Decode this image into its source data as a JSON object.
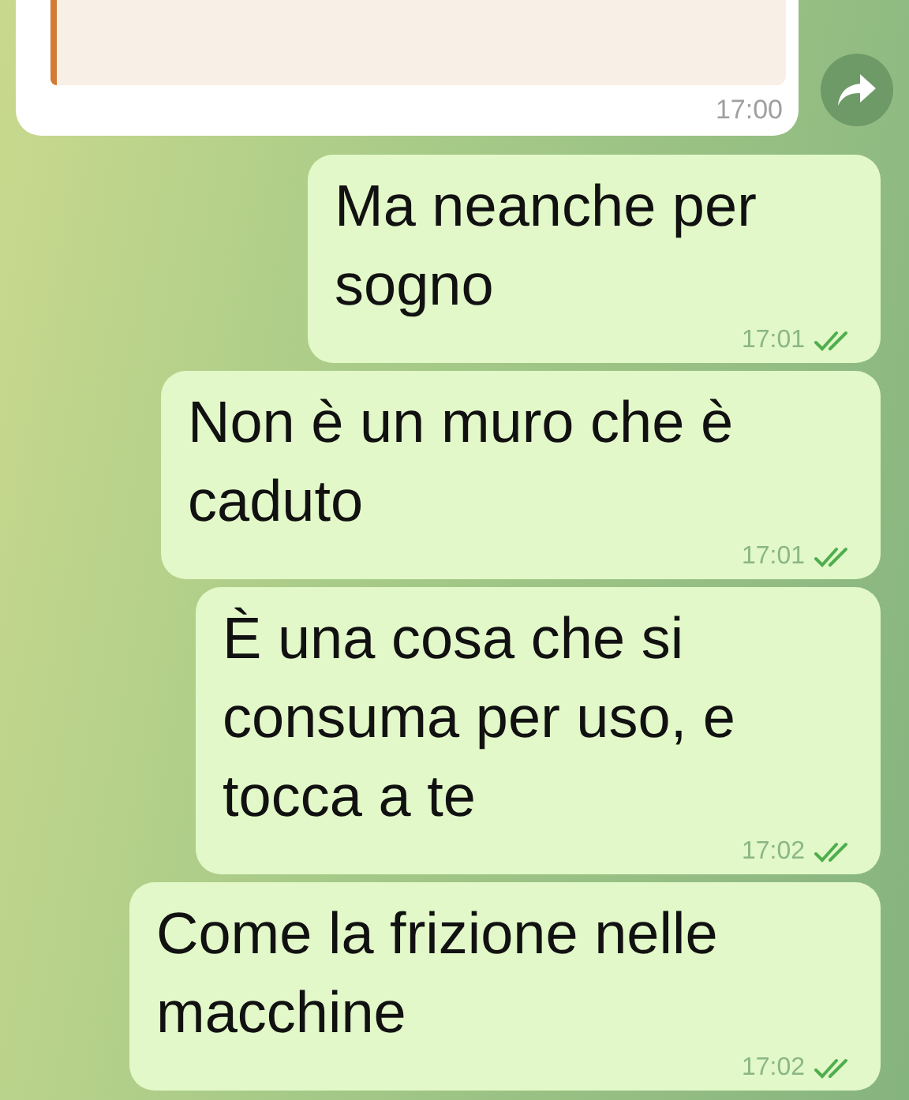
{
  "incoming": {
    "time": "17:00"
  },
  "messages": [
    {
      "text": "Ma neanche per sogno",
      "time": "17:01",
      "read": true
    },
    {
      "text": "Non è un muro che è caduto",
      "time": "17:01",
      "read": true
    },
    {
      "text": "È una cosa che si consuma per uso, e tocca a te",
      "time": "17:02",
      "read": true
    },
    {
      "text": "Come la frizione nelle macchine",
      "time": "17:02",
      "read": true
    }
  ]
}
